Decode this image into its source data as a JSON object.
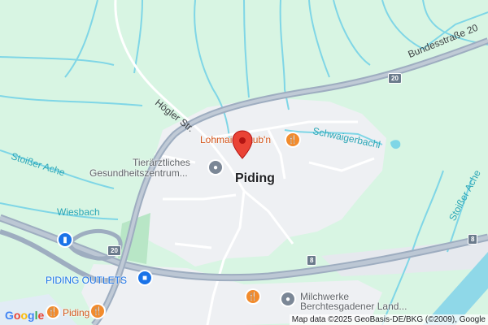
{
  "map": {
    "town_label": "Piding",
    "roads": {
      "bundesstrasse_label": "Bundesstraße 20",
      "route_20": "20",
      "route_8": "8",
      "hoegler_str": "Högler Str."
    },
    "water": {
      "stoisser_ache": "Stoißer Ache",
      "wiesbach": "Wiesbach",
      "schwaigerbachl": "Schwaigerbachl"
    },
    "pois": {
      "lohmaier_stubn": "Lohmaier Stub'n",
      "tierarzt_line1": "Tierärztliches",
      "tierarzt_line2": "Gesundheitszentrum...",
      "piding_outlets": "PIDING OUTLETS",
      "milchwerke_line1": "Milchwerke",
      "milchwerke_line2": "Berchtesgadener Land...",
      "piding_restaurant": "Piding"
    },
    "attribution": "Map data ©2025 GeoBasis-DE/BKG (©2009), Google",
    "logo": "Google"
  },
  "colors": {
    "land": "#d8f5e3",
    "urban": "#eef0f3",
    "water": "#7fd6e6",
    "highway": "#9eadc0",
    "pin": "#ea4335",
    "restaurant": "#f28b2c",
    "shopping": "#1a73e8"
  }
}
